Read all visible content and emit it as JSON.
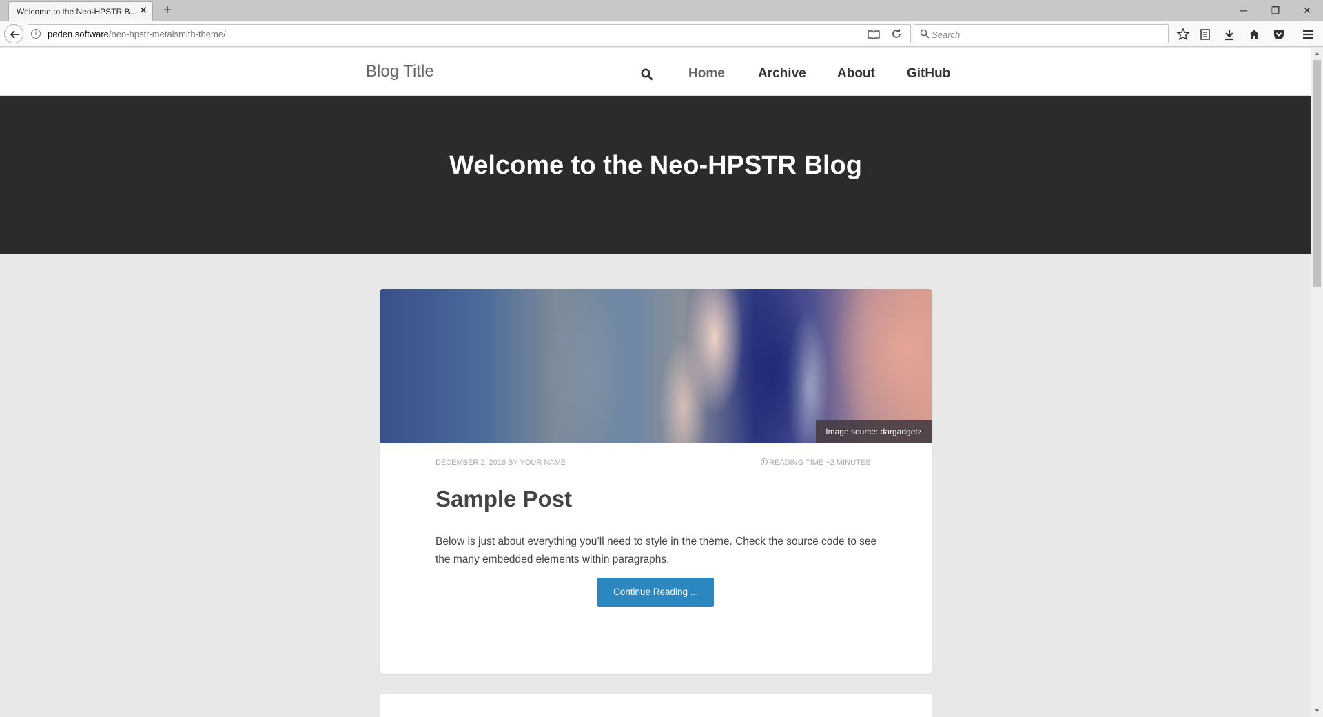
{
  "browser": {
    "tab_title": "Welcome to the Neo-HPSTR B...",
    "tab_close": "✕",
    "new_tab": "+",
    "url_host": "peden.software",
    "url_path": "/neo-hpstr-metalsmith-theme/",
    "search_placeholder": "Search",
    "window_controls": {
      "minimize": "─",
      "maximize": "❐",
      "close": "✕"
    }
  },
  "site": {
    "blog_title": "Blog Title",
    "nav": [
      "Home",
      "Archive",
      "About",
      "GitHub"
    ]
  },
  "hero": {
    "title": "Welcome to the Neo-HPSTR Blog"
  },
  "post": {
    "image_credit": "Image source: dargadgetz",
    "date_author": "December 2, 2016 by Your Name",
    "reading_time": "Reading time ~2 minutes",
    "title": "Sample Post",
    "excerpt": "Below is just about everything you’ll need to style in the theme. Check the source code to see the many embedded elements within paragraphs.",
    "button_label": "Continue Reading ..."
  },
  "colors": {
    "hero_bg": "#2b2b2b",
    "button": "#2c87c0",
    "page_bg": "#e8e8e8"
  }
}
